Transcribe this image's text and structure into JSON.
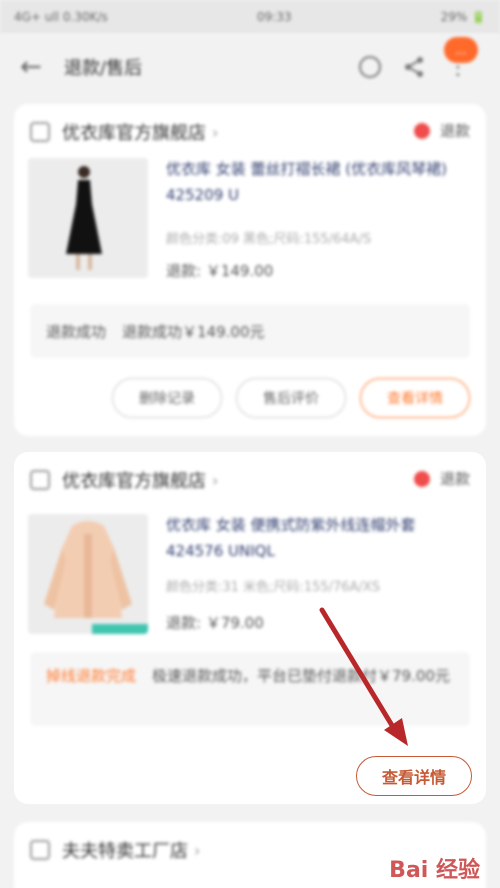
{
  "status_bar": {
    "left": "4G+ ull 0.30K/s",
    "time": "09:33",
    "right": "29% 🔋"
  },
  "nav": {
    "title": "退款/售后",
    "badge": "..."
  },
  "orders": [
    {
      "shop": "优衣库官方旗舰店",
      "status": "退款",
      "title": "优衣库 女装 蕾丝打褶长裙 (优衣库风琴裙) 425209 U",
      "spec": "颜色分类:09 黑色;尺码:155/64A/S",
      "refund": "退款: ￥149.00",
      "info_label": "退款成功",
      "info_text": "退款成功￥149.00元",
      "buttons": [
        "删除记录",
        "售后评价",
        "查看详情"
      ]
    },
    {
      "shop": "优衣库官方旗舰店",
      "status": "退款",
      "title": "优衣库 女装 便携式防紫外线连帽外套 424576 UNIQL",
      "spec": "颜色分类:31 米色;尺码:155/76A/XS",
      "refund": "退款: ￥79.00",
      "info_label": "掉线退款完成",
      "info_text": "极速退款成功，平台已垫付退款付￥79.00元",
      "buttons": [
        "查看详情"
      ]
    },
    {
      "shop": "夫夫特卖工厂店"
    }
  ],
  "watermark": "Bai 经验"
}
